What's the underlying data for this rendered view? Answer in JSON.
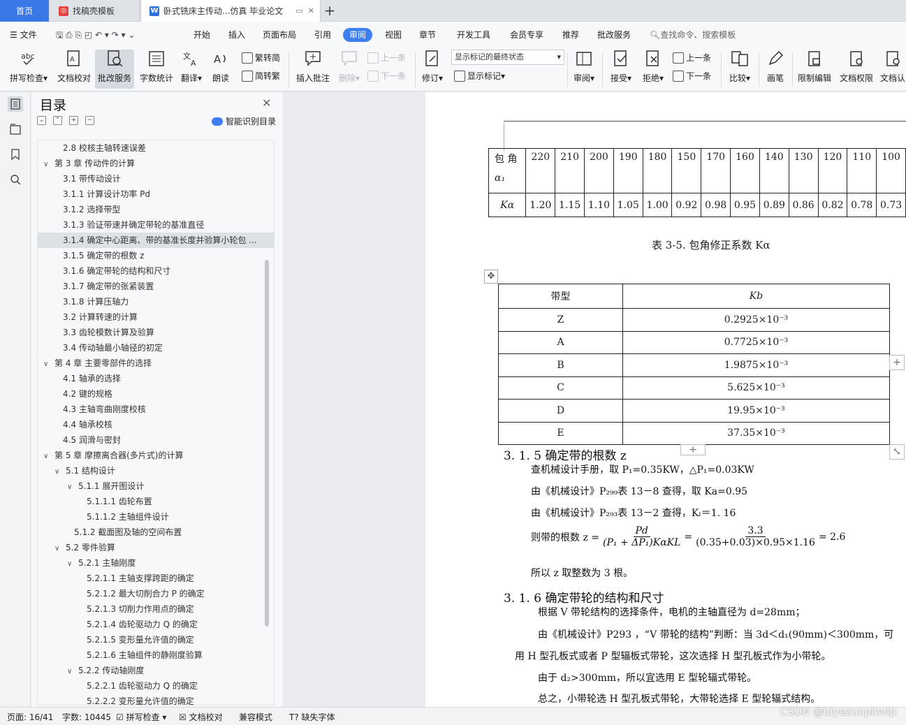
{
  "tabs": {
    "home": "首页",
    "template": "找稿壳模板",
    "doc": "卧式铣床主传动...仿真 毕业论文"
  },
  "menu": {
    "file": "文件",
    "items": [
      "开始",
      "插入",
      "页面布局",
      "引用",
      "审阅",
      "视图",
      "章节",
      "开发工具",
      "会员专享",
      "推荐",
      "批改服务"
    ],
    "active": "审阅",
    "search": "查找命令、搜索模板"
  },
  "ribbon": {
    "spell": "拼写检查",
    "doc_check": "文档校对",
    "review_service": "批改服务",
    "word_count": "字数统计",
    "translate": "翻译",
    "read": "朗读",
    "trad": "繁转简",
    "simp": "简转繁",
    "add_comment": "插入批注",
    "delete": "删除",
    "prev": "上一条",
    "next": "下一条",
    "revise": "修订",
    "markup_select": "显示标记的最终状态",
    "show_markup": "显示标记",
    "review": "审阅",
    "accept": "接受",
    "reject": "拒绝",
    "prev2": "上一条",
    "next2": "下一条",
    "compare": "比较",
    "pen": "画笔",
    "restrict": "限制编辑",
    "doc_perm": "文档权限",
    "doc_cert": "文档认"
  },
  "toc": {
    "title": "目录",
    "smart": "智能识别目录",
    "rows": [
      {
        "text": "2.8 校核主轴转速误差",
        "level": 2,
        "chev": ""
      },
      {
        "text": "第 3 章  传动件的计算",
        "level": 1,
        "chev": "∨"
      },
      {
        "text": "3.1  带传动设计",
        "level": 2,
        "chev": ""
      },
      {
        "text": "3.1.1 计算设计功率 Pd",
        "level": 2,
        "chev": ""
      },
      {
        "text": "3.1.2 选择带型",
        "level": 2,
        "chev": ""
      },
      {
        "text": "3.1.3 验证带速并确定带轮的基准直径",
        "level": 2,
        "chev": ""
      },
      {
        "text": "3.1.4 确定中心距离、带的基准长度并验算小轮包 ...",
        "level": 2,
        "chev": "",
        "sel": true
      },
      {
        "text": "3.1.5 确定带的根数 z",
        "level": 2,
        "chev": ""
      },
      {
        "text": "3.1.6 确定带轮的结构和尺寸",
        "level": 2,
        "chev": ""
      },
      {
        "text": "3.1.7 确定带的张紧装置",
        "level": 2,
        "chev": ""
      },
      {
        "text": "3.1.8 计算压轴力",
        "level": 2,
        "chev": ""
      },
      {
        "text": "3.2  计算转速的计算",
        "level": 2,
        "chev": ""
      },
      {
        "text": "3.3  齿轮模数计算及验算",
        "level": 2,
        "chev": ""
      },
      {
        "text": "3.4  传动轴最小轴径的初定",
        "level": 2,
        "chev": ""
      },
      {
        "text": "第 4 章  主要零部件的选择",
        "level": 1,
        "chev": "∨"
      },
      {
        "text": "4.1  轴承的选择",
        "level": 2,
        "chev": ""
      },
      {
        "text": "4.2  键的规格",
        "level": 2,
        "chev": ""
      },
      {
        "text": "4.3  主轴弯曲刚度校核",
        "level": 2,
        "chev": ""
      },
      {
        "text": "4.4  轴承校核",
        "level": 2,
        "chev": ""
      },
      {
        "text": "4.5  润滑与密封",
        "level": 2,
        "chev": ""
      },
      {
        "text": "第 5 章    摩擦离合器(多片式)的计算",
        "level": 1,
        "chev": "∨"
      },
      {
        "text": "5.1  结构设计",
        "level": 2,
        "chev": "∨"
      },
      {
        "text": "5.1.1  展开图设计",
        "level": 3,
        "chev": "∨"
      },
      {
        "text": "5.1.1.1  齿轮布置",
        "level": 4,
        "chev": ""
      },
      {
        "text": "5.1.1.2  主轴组件设计",
        "level": 4,
        "chev": ""
      },
      {
        "text": "5.1.2  截面图及轴的空间布置",
        "level": 3,
        "chev": ""
      },
      {
        "text": "5.2  零件验算",
        "level": 2,
        "chev": "∨"
      },
      {
        "text": "5.2.1  主轴刚度",
        "level": 3,
        "chev": "∨"
      },
      {
        "text": "5.2.1.1  主轴支撑跨距的确定",
        "level": 4,
        "chev": ""
      },
      {
        "text": "5.2.1.2  最大切削合力 P 的确定",
        "level": 4,
        "chev": ""
      },
      {
        "text": "5.2.1.3  切削力作用点的确定",
        "level": 4,
        "chev": ""
      },
      {
        "text": "5.2.1.4  齿轮驱动力 Q 的确定",
        "level": 4,
        "chev": ""
      },
      {
        "text": "5.2.1.5  变形量允许值的确定",
        "level": 4,
        "chev": ""
      },
      {
        "text": "5.2.1.6  主轴组件的静刚度验算",
        "level": 4,
        "chev": ""
      },
      {
        "text": "5.2.2  传动轴刚度",
        "level": 3,
        "chev": "∨"
      },
      {
        "text": "5.2.2.1  齿轮驱动力 Q 的确定",
        "level": 4,
        "chev": ""
      },
      {
        "text": "5.2.2.2  变形量允许值的确定",
        "level": 4,
        "chev": ""
      }
    ]
  },
  "doc": {
    "wrap_table": {
      "row1_label": "包 角",
      "row1_sub": "α₁",
      "angles": [
        "220",
        "210",
        "200",
        "190",
        "180",
        "150",
        "170",
        "160",
        "140",
        "130",
        "120",
        "110",
        "100"
      ],
      "row2_label": "Kα",
      "factors": [
        "1.20",
        "1.15",
        "1.10",
        "1.05",
        "1.00",
        "0.92",
        "0.98",
        "0.95",
        "0.89",
        "0.86",
        "0.82",
        "0.78",
        "0.73"
      ]
    },
    "caption": "表 3-5.  包角修正系数 Kα",
    "kb_table": {
      "head_type": "带型",
      "head_k": "Kb",
      "rows": [
        [
          "Z",
          "0.2925×10⁻³"
        ],
        [
          "A",
          "0.7725×10⁻³"
        ],
        [
          "B",
          "1.9875×10⁻³"
        ],
        [
          "C",
          "5.625×10⁻³"
        ],
        [
          "D",
          "19.95×10⁻³"
        ],
        [
          "E",
          "37.35×10⁻³"
        ]
      ]
    },
    "h315": "3. 1. 5 确定带的根数 z",
    "p1": "查机械设计手册，取 P₁=0.35KW，△P₁=0.03KW",
    "p2": "由《机械设计》P₂₉₉表 13－8 查得，取 Ka=0.95",
    "p3": "由《机械设计》P₂₉₃表 13－2 查得，Kₗ＝1. 16",
    "p4_prefix": "则带的根数 z =",
    "frac1_num": "Pd",
    "frac1_den": "(P₁ + ΔP₁)KαKL",
    "frac2_num": "3.3",
    "frac2_den": "(0.35+0.03)×0.95×1.16",
    "p4_result": "= 2.6",
    "p5": "所以 z 取整数为 3 根。",
    "h316": "3. 1. 6 确定带轮的结构和尺寸",
    "p6": "根据 V 带轮结构的选择条件，电机的主轴直径为 d=28mm；",
    "p7": "由《机械设计》P293 ，“V 带轮的结构”判断：当 3d＜d₁(90mm)＜300mm，可",
    "p8": "用 H 型孔板式或者 P 型辐板式带轮，这次选择 H 型孔板式作为小带轮。",
    "p9": "由于 d₂>300mm，所以宜选用 E 型轮辐式带轮。",
    "p10": "总之，小带轮选 H 型孔板式带轮，大带轮选择 E 型轮辐式结构。"
  },
  "status": {
    "page": "页面: 16/41",
    "words": "字数: 10445",
    "spell": "拼写检查",
    "doc_check": "文档校对",
    "compat": "兼容模式",
    "missing_font": "缺失字体"
  },
  "watermark": "CSDN @biyezuopinvip"
}
